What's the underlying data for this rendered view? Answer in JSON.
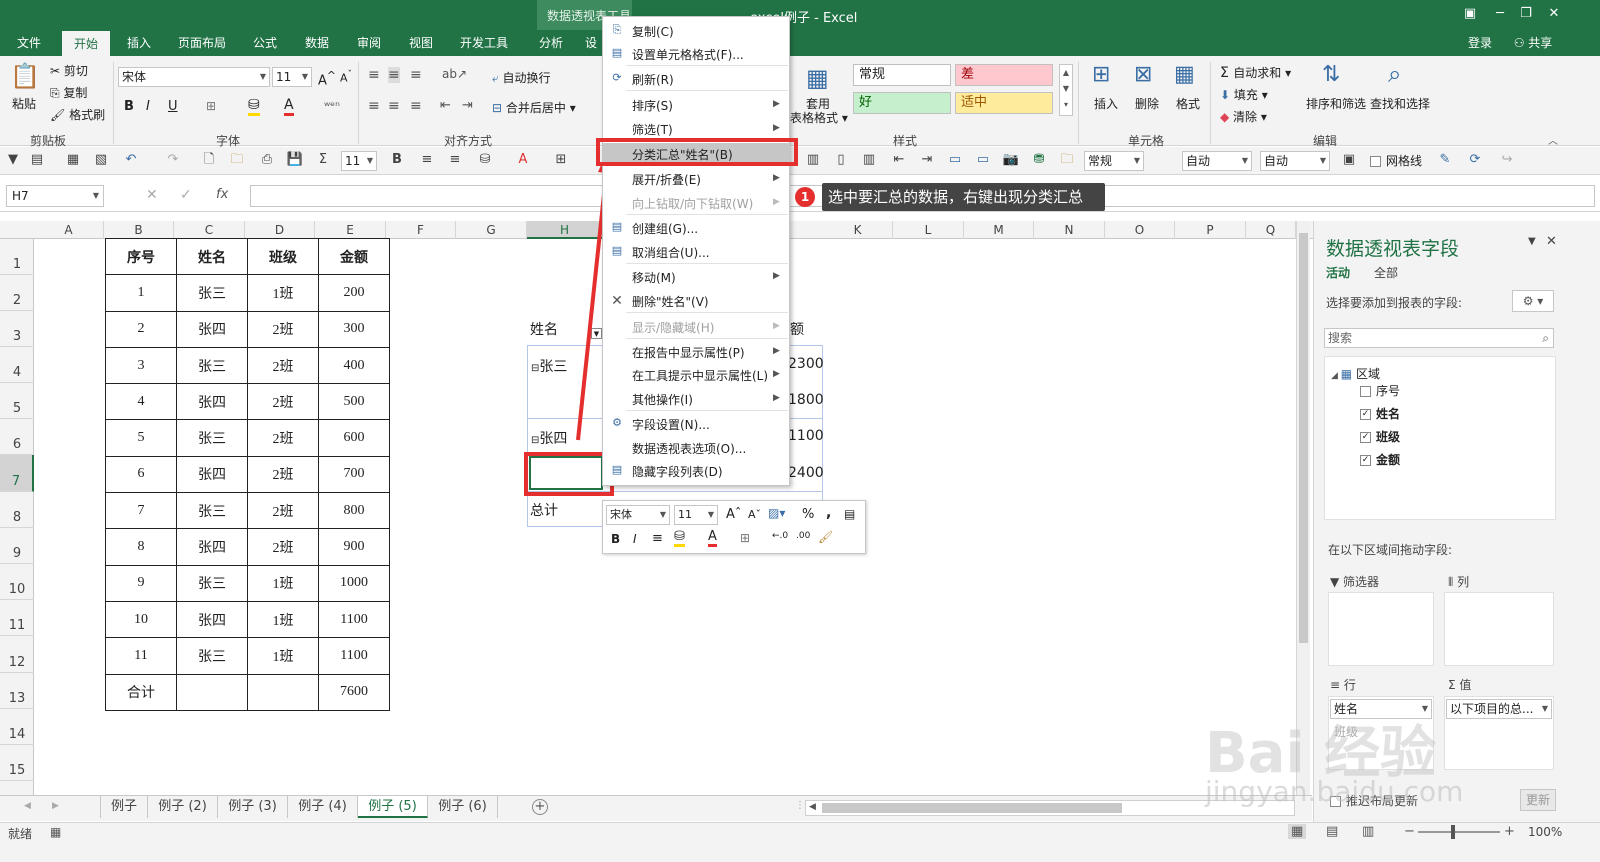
{
  "window": {
    "context_group": "数据透视表工具",
    "title": "excel例子 - Excel",
    "min_icon": "minimize-icon",
    "max_icon": "restore-icon",
    "close_icon": "close-icon"
  },
  "tabs": [
    "文件",
    "开始",
    "插入",
    "页面布局",
    "公式",
    "数据",
    "审阅",
    "视图",
    "开发工具",
    "分析",
    "设"
  ],
  "user": {
    "login": "登录",
    "share": "共享"
  },
  "ribbon": {
    "clipboard": {
      "paste": "粘贴",
      "cut": "剪切",
      "copy": "复制",
      "format_painter": "格式刷",
      "label": "剪贴板"
    },
    "font": {
      "name": "宋体",
      "size": "11",
      "label": "字体",
      "bold": "B",
      "italic": "I",
      "underline": "U"
    },
    "align": {
      "wrap": "自动换行",
      "merge": "合并后居中",
      "label": "对齐方式"
    },
    "cell_style": {
      "apply": "套用",
      "table_format": "表格格式"
    },
    "styles": {
      "normal": "常规",
      "bad": "差",
      "good": "好",
      "neutral": "适中",
      "label": "样式"
    },
    "cells": {
      "insert": "插入",
      "delete": "删除",
      "format": "格式",
      "label": "单元格"
    },
    "editing": {
      "autosum": "自动求和",
      "fill": "填充",
      "clear": "清除",
      "sort": "排序和筛选",
      "find": "查找和选择",
      "label": "编辑"
    }
  },
  "qat": {
    "font_size": "11",
    "num_format": "常规",
    "auto1": "自动",
    "auto2": "自动",
    "gridlines": "网格线"
  },
  "formula_bar": {
    "cell_ref": "H7",
    "fx": "fx"
  },
  "columns": [
    "A",
    "B",
    "C",
    "D",
    "E",
    "F",
    "G",
    "H",
    "I",
    "J",
    "K",
    "L",
    "M",
    "N",
    "O",
    "P",
    "Q"
  ],
  "rows": [
    "1",
    "2",
    "3",
    "4",
    "5",
    "6",
    "7",
    "8",
    "9",
    "10",
    "11",
    "12",
    "13",
    "14",
    "15"
  ],
  "table": {
    "headers": [
      "序号",
      "姓名",
      "班级",
      "金额"
    ],
    "rows": [
      [
        "1",
        "张三",
        "1班",
        "200"
      ],
      [
        "2",
        "张四",
        "2班",
        "300"
      ],
      [
        "3",
        "张三",
        "2班",
        "400"
      ],
      [
        "4",
        "张四",
        "2班",
        "500"
      ],
      [
        "5",
        "张三",
        "2班",
        "600"
      ],
      [
        "6",
        "张四",
        "2班",
        "700"
      ],
      [
        "7",
        "张三",
        "2班",
        "800"
      ],
      [
        "8",
        "张四",
        "2班",
        "900"
      ],
      [
        "9",
        "张三",
        "1班",
        "1000"
      ],
      [
        "10",
        "张四",
        "1班",
        "1100"
      ],
      [
        "11",
        "张三",
        "1班",
        "1100"
      ],
      [
        "合计",
        "",
        "",
        "7600"
      ]
    ]
  },
  "pivot": {
    "header_name": "姓名",
    "header_amount_frag": "额",
    "group1": "张三",
    "group2": "张四",
    "total": "总计",
    "values": [
      "2300",
      "1800",
      "1100",
      "2400"
    ]
  },
  "context_menu": {
    "items": [
      {
        "label": "复制(C)",
        "icon": "copy-icon"
      },
      {
        "label": "设置单元格格式(F)...",
        "icon": "format-cells-icon"
      },
      {
        "label": "刷新(R)",
        "icon": "refresh-icon"
      },
      {
        "label": "排序(S)"
      },
      {
        "label": "筛选(T)"
      },
      {
        "label": "分类汇总\"姓名\"(B)"
      },
      {
        "label": "展开/折叠(E)"
      },
      {
        "label": "向上钻取/向下钻取(W)"
      },
      {
        "label": "创建组(G)...",
        "icon": "group-icon"
      },
      {
        "label": "取消组合(U)...",
        "icon": "ungroup-icon"
      },
      {
        "label": "移动(M)"
      },
      {
        "label": "删除\"姓名\"(V)",
        "icon": "delete-x-icon"
      },
      {
        "label": "显示/隐藏域(H)"
      },
      {
        "label": "在报告中显示属性(P)"
      },
      {
        "label": "在工具提示中显示属性(L)"
      },
      {
        "label": "其他操作(I)"
      },
      {
        "label": "字段设置(N)...",
        "icon": "field-settings-icon"
      },
      {
        "label": "数据透视表选项(O)..."
      },
      {
        "label": "隐藏字段列表(D)",
        "icon": "hide-field-list-icon"
      }
    ]
  },
  "mini_toolbar": {
    "font": "宋体",
    "size": "11",
    "percent": "%",
    "comma": ","
  },
  "callout": {
    "number": "1",
    "text": "选中要汇总的数据，右键出现分类汇总"
  },
  "pane": {
    "title": "数据透视表字段",
    "tab_active": "活动",
    "tab_all": "全部",
    "choose": "选择要添加到报表的字段:",
    "search": "搜索",
    "area": "区域",
    "fields": [
      {
        "name": "序号",
        "checked": false
      },
      {
        "name": "姓名",
        "checked": true
      },
      {
        "name": "班级",
        "checked": true
      },
      {
        "name": "金额",
        "checked": true
      }
    ],
    "drag_hint": "在以下区域间拖动字段:",
    "filters": "筛选器",
    "cols": "列",
    "rows": "行",
    "values": "值",
    "row_field1": "姓名",
    "row_field2": "班级",
    "value_field": "以下项目的总...",
    "defer": "推迟布局更新",
    "update": "更新"
  },
  "sheets": [
    "例子",
    "例子 (2)",
    "例子 (3)",
    "例子 (4)",
    "例子 (5)",
    "例子 (6)"
  ],
  "active_sheet": "例子 (5)",
  "status": {
    "ready": "就绪",
    "zoom": "100%"
  },
  "watermark": {
    "main": "Bai 经验",
    "sub": "jingyan.baidu.com"
  },
  "colors": {
    "excel_green": "#217346",
    "highlight_red": "#e52f2f"
  }
}
